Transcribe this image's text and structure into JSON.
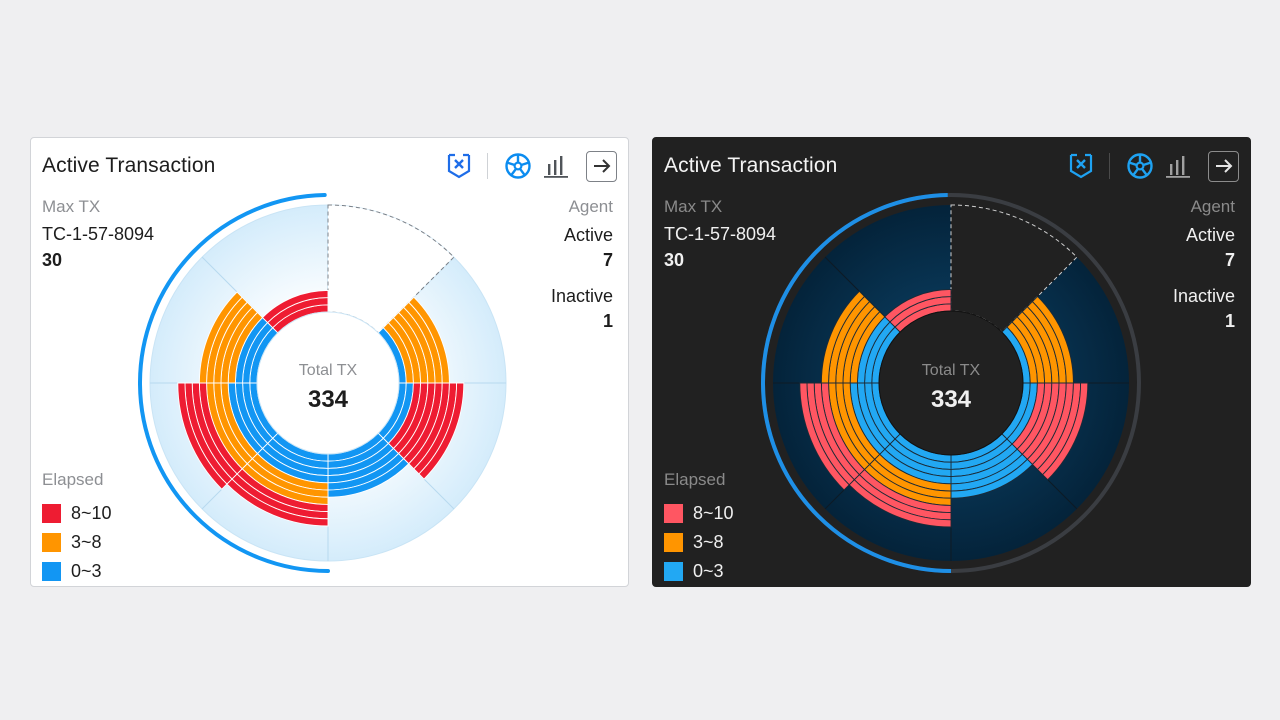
{
  "widget": {
    "title": "Active Transaction",
    "max_tx_label": "Max TX",
    "max_tx_id": "TC-1-57-8094",
    "max_tx_value": "30",
    "total_label": "Total TX",
    "total_value": "334",
    "agent_label": "Agent",
    "active_label": "Active",
    "active_value": "7",
    "inactive_label": "Inactive",
    "inactive_value": "1",
    "legend_title": "Elapsed",
    "legend": [
      {
        "label": "8~10"
      },
      {
        "label": "3~8"
      },
      {
        "label": "0~3"
      }
    ]
  },
  "toolbar_icons": [
    "shield-x-icon",
    "wheel-icon",
    "bar-chart-icon",
    "arrow-right-icon"
  ],
  "themes": {
    "light": {
      "colors": {
        "red": "#ee1c32",
        "orange": "#ff9500",
        "blue": "#1296f3",
        "accent": "#1296f3",
        "title": "#1d1d1d"
      }
    },
    "dark": {
      "colors": {
        "red": "#ff5662",
        "orange": "#ff9500",
        "blue": "#22a8f3",
        "accent": "#1e8fe6",
        "title": "#f4f4f4"
      }
    }
  },
  "chart_data": {
    "type": "polar-stacked-bar",
    "sectors": 8,
    "series_order": [
      "0~3",
      "3~8",
      "8~10"
    ],
    "agents": [
      {
        "index": 0,
        "active": false,
        "counts": [
          0,
          0,
          0
        ]
      },
      {
        "index": 1,
        "active": true,
        "counts": [
          1,
          6,
          0
        ]
      },
      {
        "index": 2,
        "active": true,
        "counts": [
          2,
          0,
          7
        ]
      },
      {
        "index": 3,
        "active": true,
        "counts": [
          6,
          0,
          0
        ]
      },
      {
        "index": 4,
        "active": true,
        "counts": [
          4,
          3,
          3
        ]
      },
      {
        "index": 5,
        "active": true,
        "counts": [
          4,
          3,
          4
        ]
      },
      {
        "index": 6,
        "active": true,
        "counts": [
          3,
          5,
          0
        ]
      },
      {
        "index": 7,
        "active": true,
        "counts": [
          0,
          0,
          3
        ]
      }
    ]
  }
}
